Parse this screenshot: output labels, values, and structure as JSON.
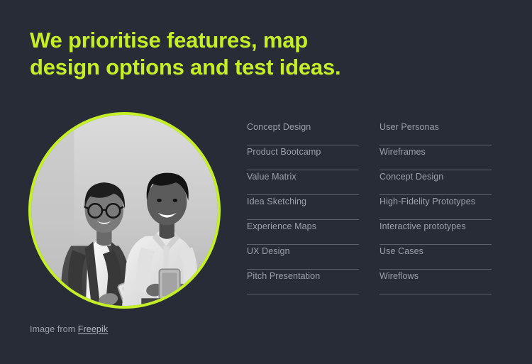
{
  "theme": {
    "background": "#282c36",
    "accent": "#c4ef27",
    "text_muted": "#9ba0ab",
    "divider": "#5c616c"
  },
  "heading": {
    "line1": "We prioritise features, map",
    "line2": "design options and test ideas."
  },
  "photo": {
    "alt": "Two colleagues smiling, one holding a tablet and one holding a phone",
    "ring_color": "#c4ef27"
  },
  "caption": {
    "prefix": "Image from ",
    "link_label": "Freepik"
  },
  "lists": {
    "column_1": [
      {
        "label": "Concept Design"
      },
      {
        "label": "Product Bootcamp"
      },
      {
        "label": "Value Matrix"
      },
      {
        "label": "Idea Sketching"
      },
      {
        "label": "Experience Maps"
      },
      {
        "label": "UX Design"
      },
      {
        "label": "Pitch Presentation"
      }
    ],
    "column_2": [
      {
        "label": "User Personas"
      },
      {
        "label": "Wireframes"
      },
      {
        "label": "Concept Design"
      },
      {
        "label": "High-Fidelity Prototypes"
      },
      {
        "label": "Interactive prototypes"
      },
      {
        "label": "Use Cases"
      },
      {
        "label": "Wireflows"
      }
    ]
  }
}
